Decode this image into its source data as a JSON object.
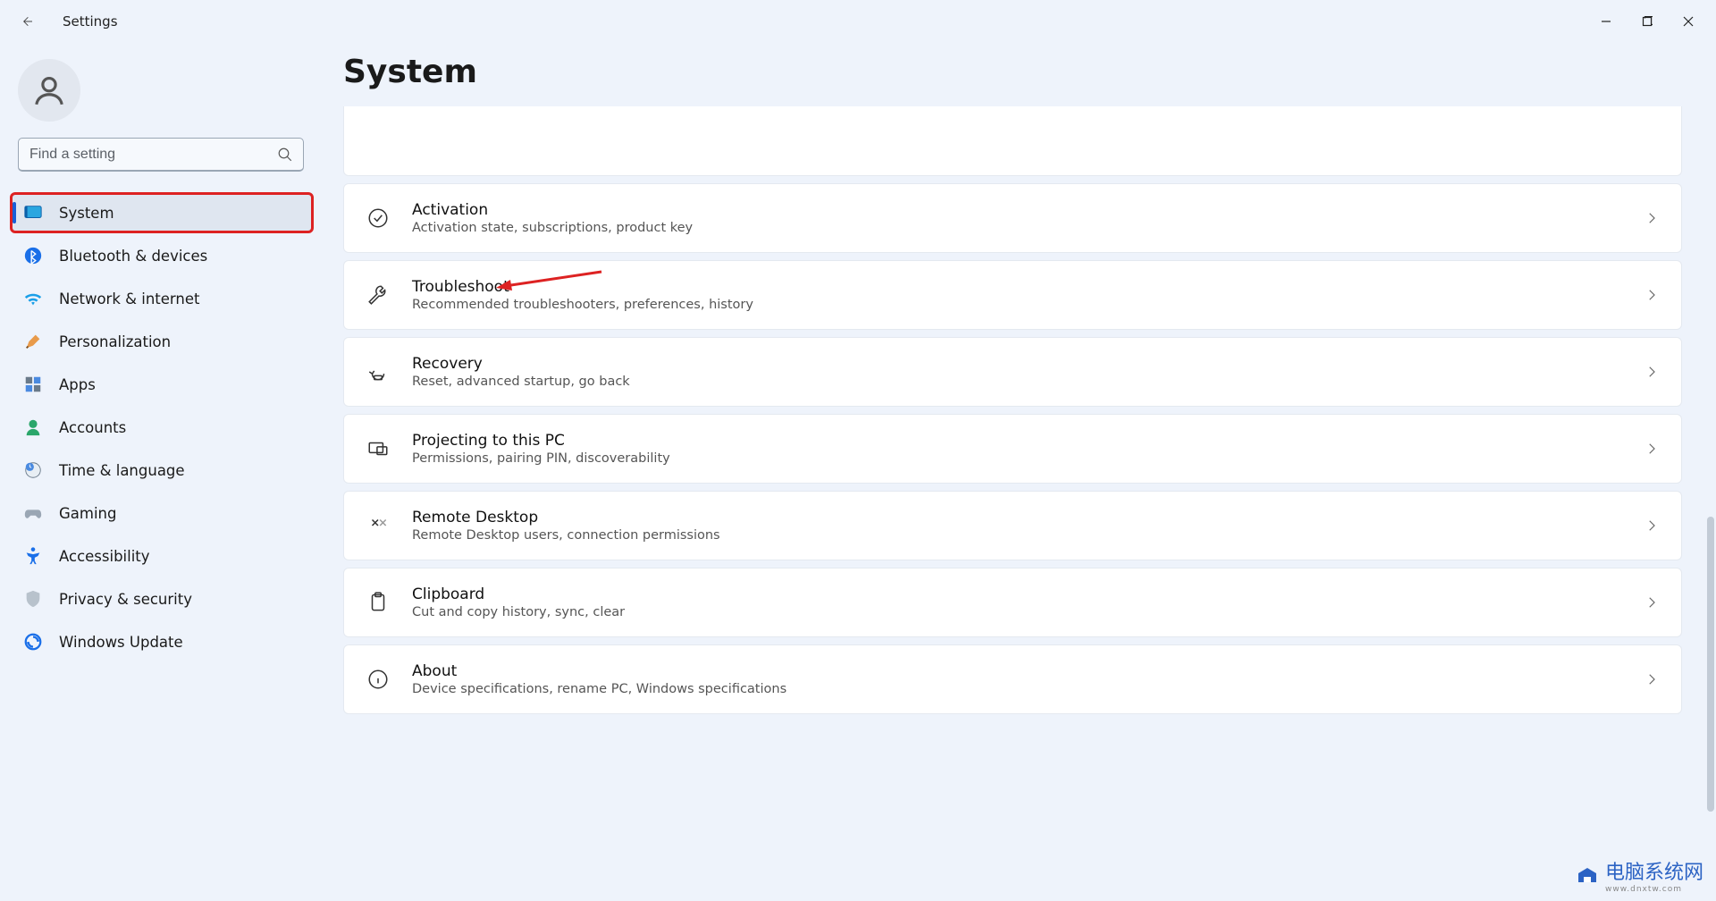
{
  "window": {
    "title": "Settings"
  },
  "search": {
    "placeholder": "Find a setting"
  },
  "page": {
    "title": "System"
  },
  "sidebar": {
    "items": [
      {
        "label": "System"
      },
      {
        "label": "Bluetooth & devices"
      },
      {
        "label": "Network & internet"
      },
      {
        "label": "Personalization"
      },
      {
        "label": "Apps"
      },
      {
        "label": "Accounts"
      },
      {
        "label": "Time & language"
      },
      {
        "label": "Gaming"
      },
      {
        "label": "Accessibility"
      },
      {
        "label": "Privacy & security"
      },
      {
        "label": "Windows Update"
      }
    ]
  },
  "cards": [
    {
      "title": "Activation",
      "sub": "Activation state, subscriptions, product key"
    },
    {
      "title": "Troubleshoot",
      "sub": "Recommended troubleshooters, preferences, history"
    },
    {
      "title": "Recovery",
      "sub": "Reset, advanced startup, go back"
    },
    {
      "title": "Projecting to this PC",
      "sub": "Permissions, pairing PIN, discoverability"
    },
    {
      "title": "Remote Desktop",
      "sub": "Remote Desktop users, connection permissions"
    },
    {
      "title": "Clipboard",
      "sub": "Cut and copy history, sync, clear"
    },
    {
      "title": "About",
      "sub": "Device specifications, rename PC, Windows specifications"
    }
  ],
  "watermark": {
    "text": "电脑系统网",
    "url": "www.dnxtw.com"
  }
}
